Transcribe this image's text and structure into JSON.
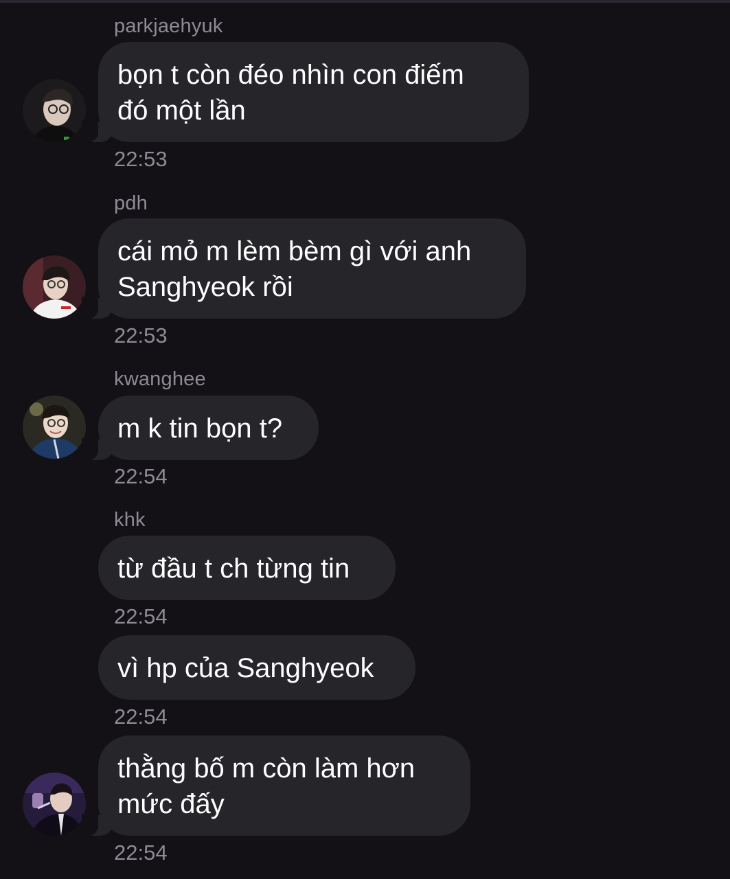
{
  "messages": [
    {
      "sender": "parkjaehyuk",
      "lines": [
        "bọn t còn đéo nhìn con điếm",
        "đó một lần"
      ],
      "time": "22:53"
    },
    {
      "sender": "pdh",
      "lines": [
        "cái mỏ m lèm bèm gì với anh",
        "Sanghyeok rồi"
      ],
      "time": "22:53"
    },
    {
      "sender": "kwanghee",
      "lines": [
        "m k tin bọn t?"
      ],
      "time": "22:54"
    },
    {
      "sender": "khk",
      "lines": [
        "từ đầu t ch từng tin"
      ],
      "time": "22:54"
    },
    {
      "sender": "",
      "lines": [
        "vì hp của Sanghyeok"
      ],
      "time": "22:54"
    },
    {
      "sender": "",
      "lines": [
        "thằng bố m còn làm hơn",
        "mức đấy"
      ],
      "time": "22:54"
    }
  ],
  "avatars": [
    "avatar-photo",
    "avatar-photo",
    "avatar-photo",
    "avatar-photo"
  ],
  "colors": {
    "background": "#131016",
    "bubble": "#26252a",
    "text": "#ffffff",
    "secondary_text": "#8e8c93"
  }
}
